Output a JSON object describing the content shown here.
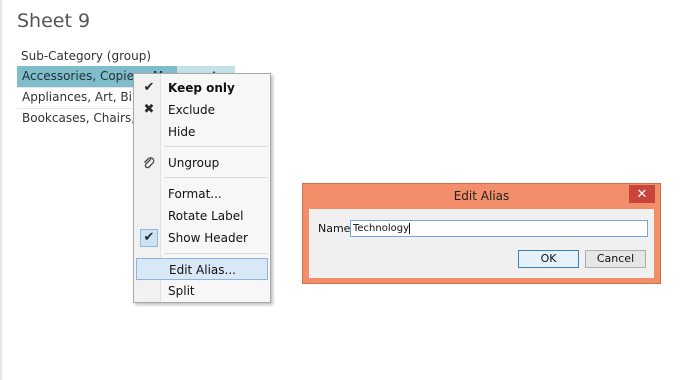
{
  "sheet": {
    "title": "Sheet 9"
  },
  "table": {
    "header": "Sub-Category (group)",
    "rows": [
      {
        "label": "Accessories, Copiers, Ma",
        "extra": "Ac",
        "selected": true
      },
      {
        "label": "Appliances, Art, Binders"
      },
      {
        "label": "Bookcases, Chairs, Furn"
      }
    ]
  },
  "context_menu": {
    "items": [
      {
        "label": "Keep only",
        "icon": "check-icon",
        "glyph": "✔"
      },
      {
        "label": "Exclude",
        "icon": "x-icon",
        "glyph": "✖"
      },
      {
        "label": "Hide"
      },
      {
        "label": "Ungroup",
        "icon": "paperclip-icon",
        "glyph": "📎"
      },
      {
        "label": "Format..."
      },
      {
        "label": "Rotate Label"
      },
      {
        "label": "Show Header",
        "icon": "check-icon",
        "glyph": "✔",
        "checked": true
      },
      {
        "label": "Edit Alias...",
        "highlighted": true
      },
      {
        "label": "Split"
      }
    ]
  },
  "dialog": {
    "title": "Edit Alias",
    "close_glyph": "✕",
    "name_label": "Name:",
    "name_value": "Technology",
    "ok_label": "OK",
    "cancel_label": "Cancel",
    "title_bar_color": "#f28f6a",
    "close_button_color": "#c7453a"
  },
  "colors": {
    "selected_row": "#80bdca",
    "menu_highlight": "#d9e8f6"
  }
}
